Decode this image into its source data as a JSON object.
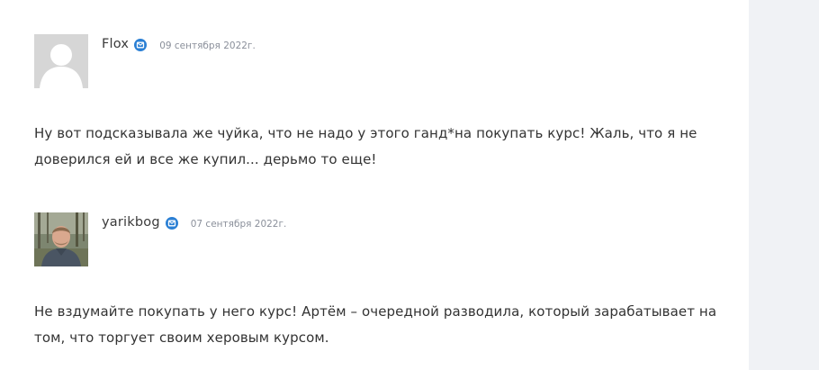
{
  "comments": [
    {
      "author": "Flox",
      "date": "09 сентября 2022г.",
      "avatar": "default-user-avatar",
      "verified_icon": "verified-badge-icon",
      "text": "Ну вот подсказывала же чуйка, что не надо у этого ганд*на покупать курс! Жаль, что я не доверился ей и все же купил... дерьмо то еще!"
    },
    {
      "author": "yarikbog",
      "date": "07 сентября 2022г.",
      "avatar": "user-photo-avatar",
      "verified_icon": "verified-badge-icon",
      "text": "Не вздумайте покупать у него курс! Артём – очередной разводила, который зарабатывает на том, что торгует своим херовым курсом."
    }
  ],
  "colors": {
    "verified": "#2a7fd4",
    "gutter": "#f0f2f5",
    "text": "#333333",
    "date": "#8a8f9a"
  }
}
